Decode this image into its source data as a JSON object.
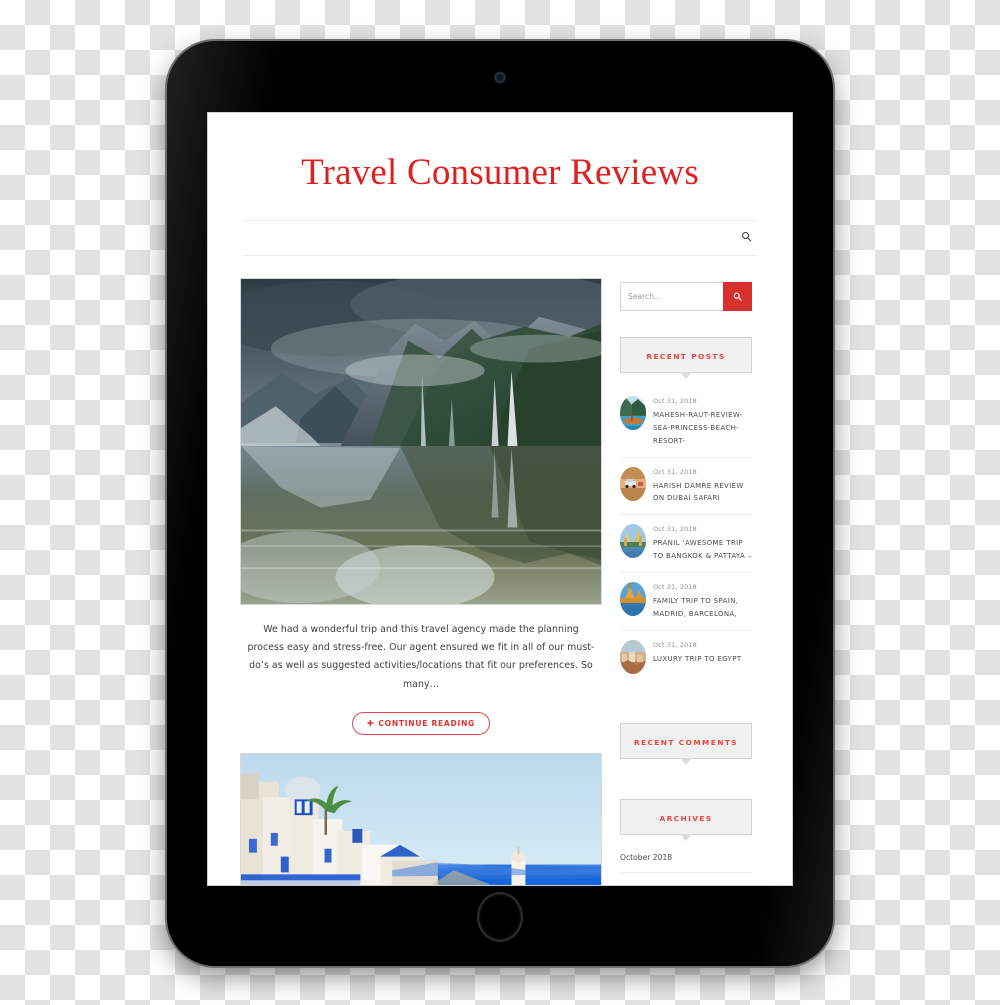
{
  "site": {
    "title": "Travel Consumer Reviews",
    "title_color": "#e02020",
    "nav_search_icon": "search-icon"
  },
  "article": {
    "hero_image_alt": "fjord-mountain-waterfall-lake",
    "excerpt": "We had a wonderful trip and this travel agency made the planning process easy and stress-free. Our agent ensured we fit in all of our must-do’s as well as suggested activities/locations that fit our preferences. So many…",
    "read_more_label": "CONTINUE READING",
    "read_more_icon": "circle-arrow-icon",
    "second_image_alt": "santorini-greek-island-white-buildings"
  },
  "sidebar": {
    "search": {
      "placeholder": "Search...",
      "value": "",
      "button_icon": "search-icon",
      "button_color": "#d6302f"
    },
    "widgets": [
      {
        "title": "RECENT POSTS"
      },
      {
        "title": "RECENT COMMENTS"
      },
      {
        "title": "ARCHIVES"
      }
    ],
    "recent_posts": [
      {
        "date": "Oct 31, 2018",
        "title": "MAHESH-RAUT-REVIEW-SEA-PRINCESS-BEACH-RESORT-",
        "thumb": "longtail-boat-lagoon"
      },
      {
        "date": "Oct 31, 2018",
        "title": "HARISH DAMRE REVIEW ON DUBAI SAFARI",
        "thumb": "desert-safari-jeep"
      },
      {
        "date": "Oct 31, 2018",
        "title": "PRANIL ‘AWESOME TRIP TO BANGKOK & PATTAYA –",
        "thumb": "bangkok-temple-river"
      },
      {
        "date": "Oct 31, 2018",
        "title": "FAMILY TRIP TO SPAIN, MADRID, BARCELONA,",
        "thumb": "spain-cathedral-sunset"
      },
      {
        "date": "Oct 31, 2018",
        "title": "LUXURY TRIP TO EGYPT",
        "thumb": "egypt-desert-city"
      }
    ],
    "archives": [
      {
        "label": "October 2018"
      }
    ]
  },
  "device": {
    "type": "tablet",
    "frame_color": "#000000",
    "home_button": "home-button",
    "camera": "front-camera"
  }
}
